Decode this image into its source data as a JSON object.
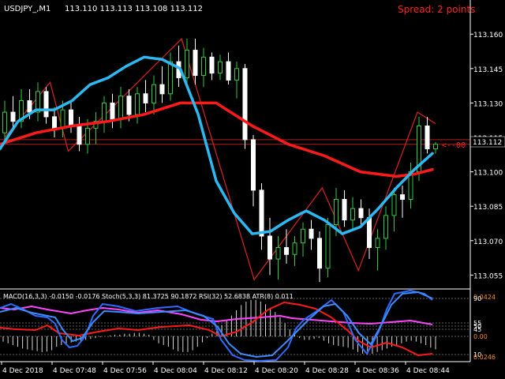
{
  "chart_header": {
    "symbol": "USDJPY_,M1",
    "ohlc": "113.110 113.113 113.108 113.112"
  },
  "spread_label": "Spread: 2 points",
  "arrow_label": "<--00",
  "current_price_tag": "113.112",
  "indicator_header": "MACD(16,3,3) -0.0150 -0.0176 Stoch(5,3,3) 81.3725 90.1872 RSI(32) 52.6838 ATR(8) 0.011",
  "colors": {
    "background": "#000000",
    "bull_candle": "#2ecc40",
    "bear_candle": "#ffffff",
    "zigzag": "#cc2222",
    "fast_ma": "#2cb8f0",
    "slow_ma": "#ff1a1a",
    "stoch_main": "#2f6bff",
    "stoch_signal": "#3b8cff",
    "rsi": "#ff44ff",
    "atr_red": "#ff1a1a",
    "spread_text": "#ff2020"
  },
  "chart_data": {
    "type": "candlestick",
    "symbol": "USDJPY",
    "timeframe": "M1",
    "price_axis_ticks": [
      "113.160",
      "113.145",
      "113.130",
      "113.115",
      "113.100",
      "113.085",
      "113.070",
      "113.055"
    ],
    "price_range": [
      113.051,
      113.168
    ],
    "time_axis_ticks": [
      "4 Dec 2018",
      "4 Dec 07:48",
      "4 Dec 07:56",
      "4 Dec 08:04",
      "4 Dec 08:12",
      "4 Dec 08:20",
      "4 Dec 08:28",
      "4 Dec 08:36",
      "4 Dec 08:44"
    ],
    "horizontal_lines": [
      113.114,
      113.112
    ],
    "candles": [
      [
        113.117,
        113.131,
        113.114,
        113.126
      ],
      [
        113.126,
        113.133,
        113.118,
        113.122
      ],
      [
        113.122,
        113.136,
        113.119,
        113.131
      ],
      [
        113.131,
        113.136,
        113.123,
        113.126
      ],
      [
        113.126,
        113.139,
        113.122,
        113.135
      ],
      [
        113.135,
        113.137,
        113.121,
        113.124
      ],
      [
        113.124,
        113.128,
        113.115,
        113.119
      ],
      [
        113.119,
        113.131,
        113.115,
        113.127
      ],
      [
        113.127,
        113.131,
        113.117,
        113.12
      ],
      [
        113.12,
        113.124,
        113.109,
        113.112
      ],
      [
        113.112,
        113.123,
        113.108,
        113.119
      ],
      [
        113.119,
        113.126,
        113.112,
        113.122
      ],
      [
        113.122,
        113.133,
        113.117,
        113.13
      ],
      [
        113.13,
        113.134,
        113.119,
        113.123
      ],
      [
        113.123,
        113.137,
        113.119,
        113.133
      ],
      [
        113.133,
        113.136,
        113.122,
        113.125
      ],
      [
        113.125,
        113.137,
        113.121,
        113.134
      ],
      [
        113.134,
        113.14,
        113.126,
        113.13
      ],
      [
        113.13,
        113.142,
        113.125,
        113.138
      ],
      [
        113.138,
        113.146,
        113.13,
        113.134
      ],
      [
        113.134,
        113.152,
        113.131,
        113.148
      ],
      [
        113.148,
        113.155,
        113.137,
        113.141
      ],
      [
        113.141,
        113.158,
        113.137,
        113.153
      ],
      [
        113.153,
        113.158,
        113.138,
        113.142
      ],
      [
        113.142,
        113.154,
        113.137,
        113.15
      ],
      [
        113.15,
        113.152,
        113.14,
        113.143
      ],
      [
        113.143,
        113.151,
        113.14,
        113.148
      ],
      [
        113.148,
        113.152,
        113.138,
        113.14
      ],
      [
        113.14,
        113.148,
        113.132,
        113.145
      ],
      [
        113.145,
        113.147,
        113.11,
        113.114
      ],
      [
        113.114,
        113.116,
        113.085,
        113.092
      ],
      [
        113.092,
        113.095,
        113.066,
        113.072
      ],
      [
        113.072,
        113.08,
        113.055,
        113.062
      ],
      [
        113.062,
        113.072,
        113.053,
        113.067
      ],
      [
        113.067,
        113.075,
        113.06,
        113.064
      ],
      [
        113.064,
        113.072,
        113.059,
        113.069
      ],
      [
        113.069,
        113.078,
        113.063,
        113.075
      ],
      [
        113.075,
        113.079,
        113.066,
        113.071
      ],
      [
        113.071,
        113.074,
        113.052,
        113.058
      ],
      [
        113.058,
        113.08,
        113.054,
        113.077
      ],
      [
        113.077,
        113.093,
        113.072,
        113.088
      ],
      [
        113.088,
        113.092,
        113.076,
        113.079
      ],
      [
        113.079,
        113.089,
        113.075,
        113.084
      ],
      [
        113.084,
        113.088,
        113.077,
        113.08
      ],
      [
        113.08,
        113.084,
        113.062,
        113.067
      ],
      [
        113.067,
        113.075,
        113.057,
        113.071
      ],
      [
        113.071,
        113.085,
        113.066,
        113.081
      ],
      [
        113.081,
        113.093,
        113.074,
        113.09
      ],
      [
        113.09,
        113.094,
        113.08,
        113.088
      ],
      [
        113.088,
        113.104,
        113.084,
        113.1
      ],
      [
        113.1,
        113.124,
        113.096,
        113.12
      ],
      [
        113.12,
        113.124,
        113.108,
        113.11
      ],
      [
        113.11,
        113.113,
        113.108,
        113.112
      ]
    ],
    "zigzag": [
      [
        0,
        113.115
      ],
      [
        10,
        113.139
      ],
      [
        14,
        113.109
      ],
      [
        39,
        113.158
      ],
      [
        55,
        113.053
      ],
      [
        70,
        113.093
      ],
      [
        78,
        113.057
      ],
      [
        91,
        113.126
      ],
      [
        95,
        113.121
      ]
    ],
    "fast_ma": [
      [
        0,
        113.11
      ],
      [
        6,
        113.122
      ],
      [
        12,
        113.127
      ],
      [
        18,
        113.127
      ],
      [
        24,
        113.131
      ],
      [
        30,
        113.138
      ],
      [
        36,
        113.141
      ],
      [
        42,
        113.146
      ],
      [
        48,
        113.15
      ],
      [
        54,
        113.149
      ],
      [
        60,
        113.145
      ],
      [
        66,
        113.125
      ],
      [
        72,
        113.096
      ],
      [
        78,
        113.082
      ],
      [
        84,
        113.073
      ],
      [
        90,
        113.074
      ],
      [
        96,
        113.079
      ],
      [
        102,
        113.083
      ],
      [
        108,
        113.079
      ],
      [
        114,
        113.073
      ],
      [
        120,
        113.076
      ],
      [
        126,
        113.084
      ],
      [
        132,
        113.093
      ],
      [
        138,
        113.101
      ],
      [
        144,
        113.108
      ]
    ],
    "slow_ma": [
      [
        0,
        113.112
      ],
      [
        12,
        113.117
      ],
      [
        24,
        113.12
      ],
      [
        36,
        113.122
      ],
      [
        48,
        113.125
      ],
      [
        60,
        113.13
      ],
      [
        72,
        113.13
      ],
      [
        84,
        113.12
      ],
      [
        96,
        113.112
      ],
      [
        108,
        113.107
      ],
      [
        120,
        113.1
      ],
      [
        132,
        113.098
      ],
      [
        138,
        113.099
      ],
      [
        144,
        113.101
      ]
    ],
    "indicator": {
      "levels_right": [
        "0.0424",
        "90",
        "55",
        "50",
        "45",
        "0.00",
        "10",
        "0.0246"
      ],
      "macd_histogram": [
        -0.006,
        -0.008,
        -0.01,
        -0.012,
        -0.014,
        -0.015,
        -0.016,
        -0.017,
        -0.018,
        -0.0175,
        -0.016,
        -0.012,
        -0.01,
        -0.008,
        -0.007,
        -0.006,
        -0.005,
        -0.004,
        -0.003,
        -0.002,
        -0.001,
        0.0,
        0.001,
        0.002,
        0.002,
        0.003,
        0.003,
        0.004,
        0.004,
        0.003,
        0.002,
        -0.004,
        -0.008,
        -0.01,
        -0.012,
        -0.015,
        -0.017,
        -0.018,
        -0.018,
        -0.016,
        -0.012,
        -0.007,
        -0.002,
        0.003,
        0.008,
        0.013,
        0.018,
        0.024,
        0.03,
        0.036,
        0.04,
        0.042,
        0.042,
        0.04,
        0.037,
        0.033,
        0.028,
        0.022,
        0.015,
        0.008,
        0.002,
        -0.002,
        -0.004,
        -0.004,
        -0.003,
        -0.002,
        -0.005,
        -0.008,
        -0.01,
        -0.011,
        -0.012,
        -0.013,
        -0.015,
        -0.018,
        -0.02,
        -0.021,
        -0.02,
        -0.018,
        -0.016,
        -0.014,
        -0.012,
        -0.01,
        -0.008,
        -0.006,
        -0.005,
        -0.006,
        -0.008,
        -0.01,
        -0.013,
        -0.015
      ]
    }
  }
}
